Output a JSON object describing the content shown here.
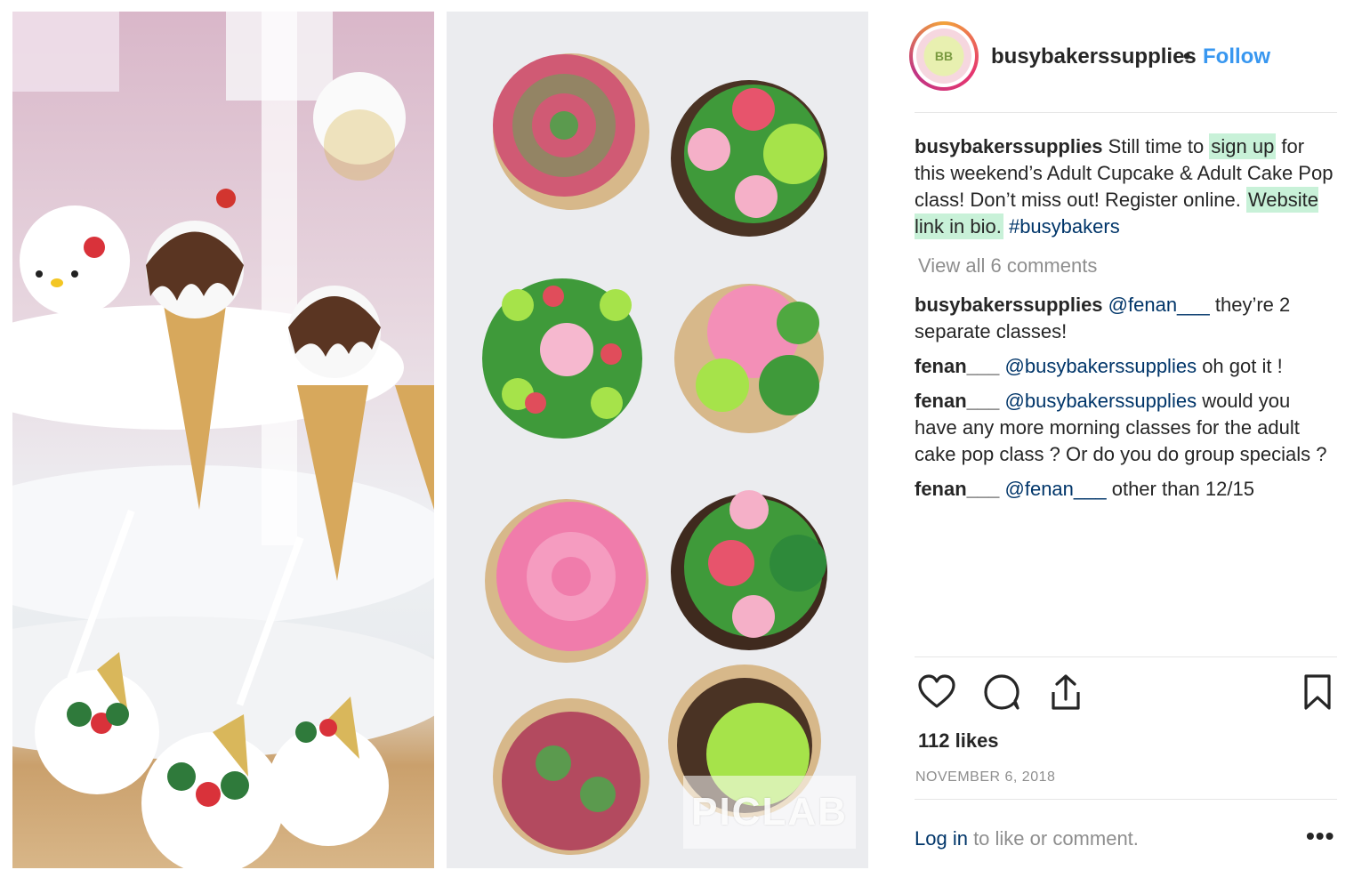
{
  "post": {
    "username": "busybakerssupplies",
    "follow_label": "Follow",
    "separator": "•",
    "avatar_text": "BB",
    "watermark": "PICLAB"
  },
  "caption": {
    "username": "busybakerssupplies",
    "text_1": " Still time to ",
    "highlight_1": "sign up",
    "text_2": " for this weekend’s Adult Cupcake & Adult Cake Pop class! Don’t miss out! Register online. ",
    "highlight_2": "Website link in bio.",
    "hashtag": " #busybakers"
  },
  "view_all": "View all 6 comments",
  "comments": [
    {
      "user": "busybakerssupplies",
      "mention": "@fenan___",
      "text": " they’re 2 separate classes!"
    },
    {
      "user": "fenan___",
      "mention": "@busybakerssupplies",
      "text": " oh got it !"
    },
    {
      "user": "fenan___",
      "mention": "@busybakerssupplies",
      "text": " would you have any more morning classes for the adult cake pop class ? Or do you do group specials ?"
    },
    {
      "user": "fenan___",
      "mention": "@fenan___",
      "text": " other than 12/15"
    }
  ],
  "actions": {
    "like_icon": "heart-icon",
    "comment_icon": "comment-icon",
    "share_icon": "share-icon",
    "save_icon": "bookmark-icon"
  },
  "likes": "112 likes",
  "date": "NOVEMBER 6, 2018",
  "login": {
    "link": "Log in",
    "text": " to like or comment.",
    "more": "•••"
  },
  "colors": {
    "link_blue": "#3897f0",
    "mention": "#003569",
    "highlight": "#c8f1d8",
    "muted": "#8e8e8e"
  }
}
